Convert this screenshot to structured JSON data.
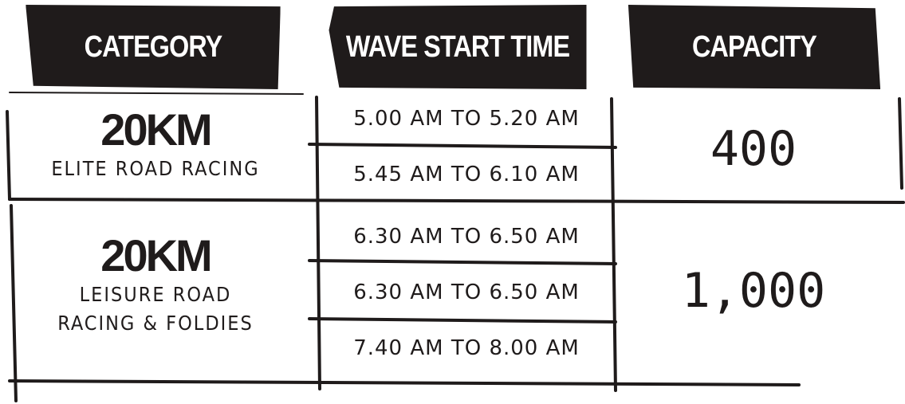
{
  "headers": {
    "category": "CATEGORY",
    "wave_start_time": "WAVE START TIME",
    "capacity": "CAPACITY"
  },
  "rows": [
    {
      "distance": "20KM",
      "subtitle_lines": [
        "ELITE ROAD RACING"
      ],
      "waves": [
        "5.00 AM TO 5.20 AM",
        "5.45 AM TO 6.10 AM"
      ],
      "capacity": "400"
    },
    {
      "distance": "20KM",
      "subtitle_lines": [
        "LEISURE ROAD",
        "RACING & FOLDIES"
      ],
      "waves": [
        "6.30 AM TO 6.50 AM",
        "6.30 AM TO 6.50 AM",
        "7.40 AM TO 8.00 AM"
      ],
      "capacity": "1,000"
    }
  ],
  "colors": {
    "ink": "#1f1b1b",
    "header_text": "#ffffff",
    "background": "#ffffff"
  }
}
